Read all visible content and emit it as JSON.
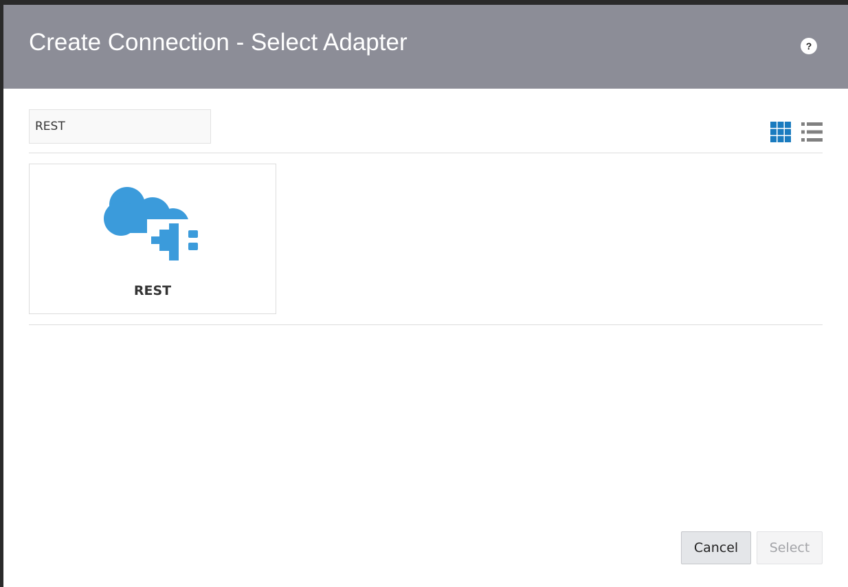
{
  "dialog": {
    "title": "Create Connection - Select Adapter",
    "help_label": "?"
  },
  "search": {
    "value": "REST",
    "placeholder": ""
  },
  "view_toggles": {
    "grid_icon": "grid-view-icon",
    "list_icon": "list-view-icon",
    "active": "grid",
    "active_color": "#1a7bbf",
    "inactive_color": "#808080"
  },
  "adapters": [
    {
      "label": "REST",
      "icon": "cloud-plug-icon",
      "icon_color": "#3b9bdb"
    }
  ],
  "footer": {
    "cancel_label": "Cancel",
    "select_label": "Select",
    "select_enabled": false
  },
  "colors": {
    "header_bg": "#8c8d97",
    "backdrop": "#2a2a2a"
  }
}
